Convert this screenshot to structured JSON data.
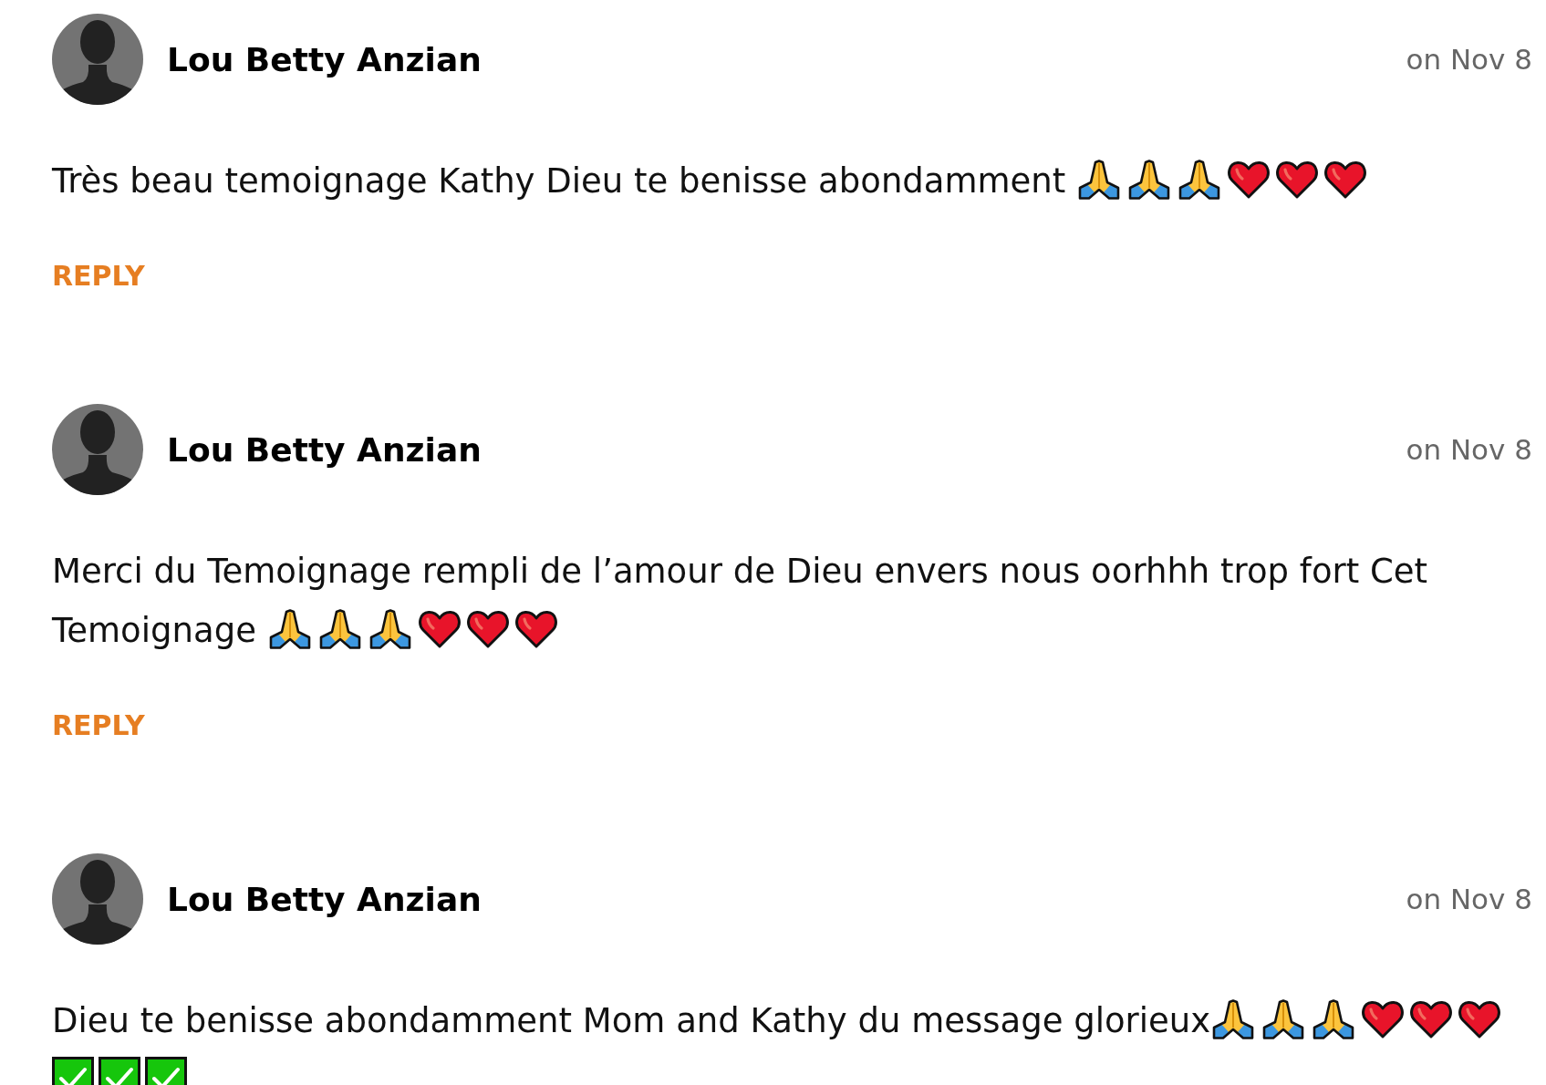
{
  "comments": [
    {
      "author": "Lou Betty Anzian",
      "date": "on Nov 8",
      "body": [
        {
          "text": "Très beau temoignage Kathy Dieu te benisse abondamment ",
          "emojis": [
            {
              "kind": "folded-hands"
            },
            {
              "kind": "folded-hands"
            },
            {
              "kind": "folded-hands"
            },
            {
              "kind": "heart"
            },
            {
              "kind": "heart"
            },
            {
              "kind": "heart"
            }
          ]
        }
      ],
      "reply": "REPLY"
    },
    {
      "author": "Lou Betty Anzian",
      "date": "on Nov 8",
      "body": [
        {
          "text": "Merci du Temoignage rempli de l’amour de Dieu envers nous oorhhh trop fort Cet"
        },
        {
          "text": "Temoignage ",
          "emojis": [
            {
              "kind": "folded-hands"
            },
            {
              "kind": "folded-hands"
            },
            {
              "kind": "folded-hands"
            },
            {
              "kind": "heart"
            },
            {
              "kind": "heart"
            },
            {
              "kind": "heart"
            }
          ]
        }
      ],
      "reply": "REPLY"
    },
    {
      "author": "Lou Betty Anzian",
      "date": "on Nov 8",
      "body": [
        {
          "text": "Dieu te benisse abondamment Mom and Kathy du message glorieux",
          "emojis": [
            {
              "kind": "folded-hands"
            },
            {
              "kind": "folded-hands"
            },
            {
              "kind": "folded-hands"
            },
            {
              "kind": "heart"
            },
            {
              "kind": "heart"
            },
            {
              "kind": "heart"
            },
            {
              "kind": "check"
            },
            {
              "kind": "check"
            },
            {
              "kind": "check"
            }
          ]
        }
      ]
    }
  ]
}
